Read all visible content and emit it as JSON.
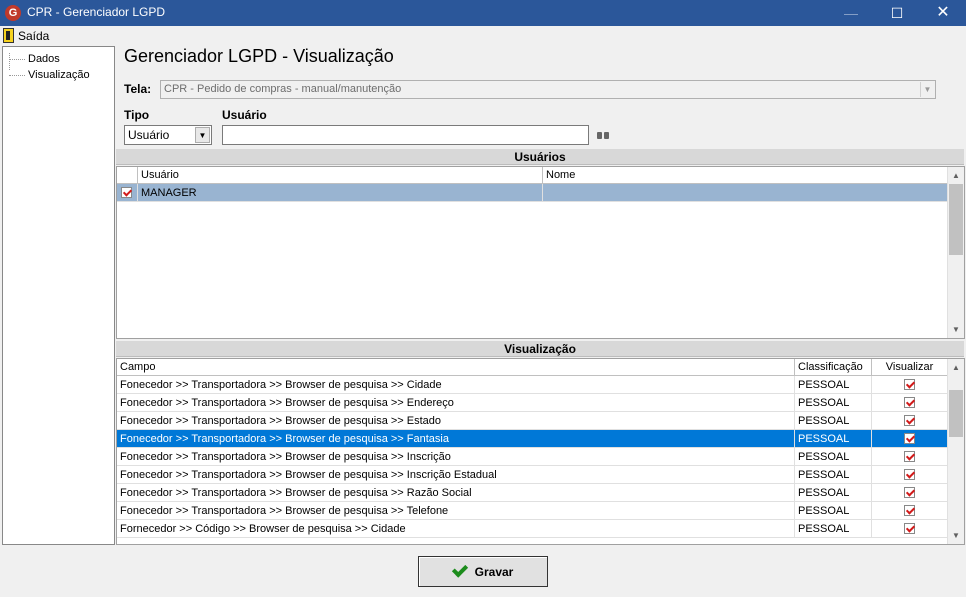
{
  "window": {
    "title": "CPR - Gerenciador LGPD",
    "app_icon_letter": "G"
  },
  "menu": {
    "saida": "Saída"
  },
  "tree": {
    "items": [
      "Dados",
      "Visualização"
    ]
  },
  "page": {
    "heading": "Gerenciador LGPD - Visualização"
  },
  "tela": {
    "label": "Tela:",
    "value": "CPR - Pedido de compras - manual/manutenção"
  },
  "tipo": {
    "label": "Tipo",
    "value": "Usuário"
  },
  "usuario": {
    "label": "Usuário",
    "value": ""
  },
  "usuarios_section": {
    "title": "Usuários",
    "columns": [
      "Usuário",
      "Nome"
    ],
    "rows": [
      {
        "checked": true,
        "usuario": "MANAGER",
        "nome": ""
      }
    ]
  },
  "visualizacao_section": {
    "title": "Visualização",
    "columns": [
      "Campo",
      "Classificação",
      "Visualizar"
    ],
    "rows": [
      {
        "campo": "Fonecedor >> Transportadora >> Browser de pesquisa >> Cidade",
        "classificacao": "PESSOAL",
        "visualizar": true
      },
      {
        "campo": "Fonecedor >> Transportadora >> Browser de pesquisa >> Endereço",
        "classificacao": "PESSOAL",
        "visualizar": true
      },
      {
        "campo": "Fonecedor >> Transportadora >> Browser de pesquisa >> Estado",
        "classificacao": "PESSOAL",
        "visualizar": true
      },
      {
        "campo": "Fonecedor >> Transportadora >> Browser de pesquisa >> Fantasia",
        "classificacao": "PESSOAL",
        "visualizar": true
      },
      {
        "campo": "Fonecedor >> Transportadora >> Browser de pesquisa >> Inscrição",
        "classificacao": "PESSOAL",
        "visualizar": true
      },
      {
        "campo": "Fonecedor >> Transportadora >> Browser de pesquisa >> Inscrição Estadual",
        "classificacao": "PESSOAL",
        "visualizar": true
      },
      {
        "campo": "Fonecedor >> Transportadora >> Browser de pesquisa >> Razão Social",
        "classificacao": "PESSOAL",
        "visualizar": true
      },
      {
        "campo": "Fonecedor >> Transportadora >> Browser de pesquisa >> Telefone",
        "classificacao": "PESSOAL",
        "visualizar": true
      },
      {
        "campo": "Fornecedor >> Código >> Browser de pesquisa >> Cidade",
        "classificacao": "PESSOAL",
        "visualizar": true
      }
    ]
  },
  "actions": {
    "gravar": "Gravar"
  },
  "colors": {
    "title_bar": "#2b579a",
    "selection": "#0078d7",
    "selection_light": "#99b4d1",
    "check": "#d21a1a",
    "ok_green": "#1c8c1c"
  }
}
